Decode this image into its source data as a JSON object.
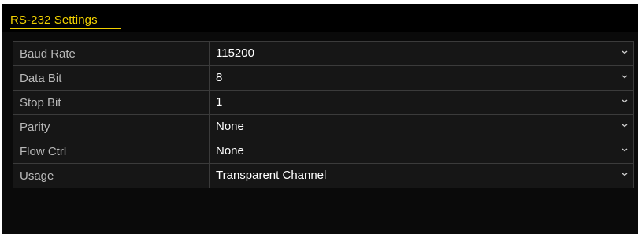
{
  "panel": {
    "title": "RS-232 Settings",
    "title_color": "#f2d100"
  },
  "settings": [
    {
      "label": "Baud Rate",
      "value": "115200",
      "icon": "chevron-down-icon"
    },
    {
      "label": "Data Bit",
      "value": "8",
      "icon": "chevron-down-icon"
    },
    {
      "label": "Stop Bit",
      "value": "1",
      "icon": "chevron-down-icon"
    },
    {
      "label": "Parity",
      "value": "None",
      "icon": "chevron-down-icon"
    },
    {
      "label": "Flow Ctrl",
      "value": "None",
      "icon": "chevron-down-icon"
    },
    {
      "label": "Usage",
      "value": "Transparent Channel",
      "icon": "chevron-down-icon"
    }
  ]
}
